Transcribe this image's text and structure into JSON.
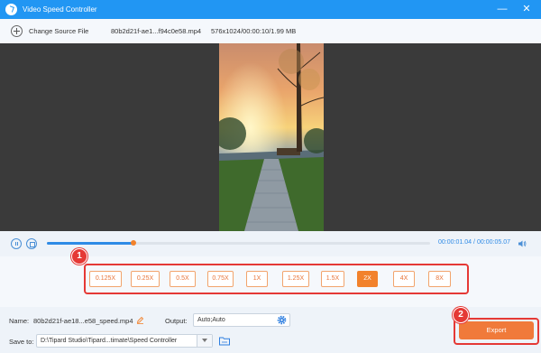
{
  "window": {
    "title": "Video Speed Controller",
    "min_glyph": "—",
    "close_glyph": "✕"
  },
  "toolbar": {
    "change_source_label": "Change Source File",
    "file_name": "80b2d21f-ae1...f94c0e58.mp4",
    "file_info": "576x1024/00:00:10/1.99 MB"
  },
  "playback": {
    "current_time": "00:00:01.04",
    "separator": "/",
    "total_time": "00:00:05.07",
    "progress_fraction": 0.225
  },
  "speed_options": [
    {
      "label": "0.125X",
      "active": false
    },
    {
      "label": "0.25X",
      "active": false
    },
    {
      "label": "0.5X",
      "active": false
    },
    {
      "label": "0.75X",
      "active": false
    },
    {
      "label": "1X",
      "active": false
    },
    {
      "label": "1.25X",
      "active": false
    },
    {
      "label": "1.5X",
      "active": false
    },
    {
      "label": "2X",
      "active": true
    },
    {
      "label": "4X",
      "active": false
    },
    {
      "label": "8X",
      "active": false
    }
  ],
  "markers": {
    "one": "1",
    "two": "2"
  },
  "output_settings": {
    "name_label": "Name:",
    "name_value": "80b2d21f-ae18...e58_speed.mp4",
    "output_label": "Output:",
    "output_value": "Auto;Auto",
    "save_to_label": "Save to:",
    "save_to_value": "D:\\Tipard Studio\\Tipard...timate\\Speed Controller",
    "export_label": "Export"
  },
  "colors": {
    "accent": "#2196f3",
    "orange": "#f2822c",
    "highlight_red": "#e53935"
  }
}
